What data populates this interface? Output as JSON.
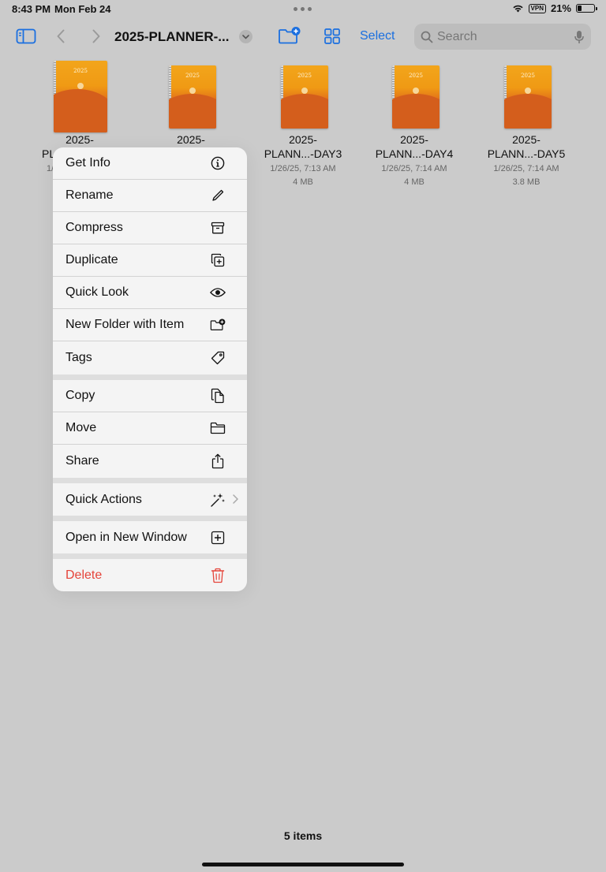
{
  "status_bar": {
    "time": "8:43 PM",
    "date": "Mon Feb 24",
    "vpn": "VPN",
    "battery": "21%"
  },
  "toolbar": {
    "title": "2025-PLANNER-...",
    "select_label": "Select",
    "search_placeholder": "Search",
    "accent_color": "#1a6fe0"
  },
  "files": [
    {
      "name_line1": "2025-",
      "name_line2": "PL",
      "meta_date": "1/",
      "meta_size": ""
    },
    {
      "name_line1": "2025-",
      "name_line2": "",
      "meta_date": "",
      "meta_size": ""
    },
    {
      "name_line1": "2025-",
      "name_line2": "PLANN...-DAY3",
      "meta_date": "1/26/25, 7:13 AM",
      "meta_size": "4 MB"
    },
    {
      "name_line1": "2025-",
      "name_line2": "PLANN...-DAY4",
      "meta_date": "1/26/25, 7:14 AM",
      "meta_size": "4 MB"
    },
    {
      "name_line1": "2025-",
      "name_line2": "PLANN...-DAY5",
      "meta_date": "1/26/25, 7:14 AM",
      "meta_size": "3.8 MB"
    }
  ],
  "thumbnail_year": "2025",
  "context_menu": {
    "items": [
      {
        "label": "Get Info",
        "icon": "info-icon"
      },
      {
        "label": "Rename",
        "icon": "pencil-icon"
      },
      {
        "label": "Compress",
        "icon": "archive-box-icon"
      },
      {
        "label": "Duplicate",
        "icon": "duplicate-icon"
      },
      {
        "label": "Quick Look",
        "icon": "eye-icon"
      },
      {
        "label": "New Folder with Item",
        "icon": "folder-plus-icon"
      },
      {
        "label": "Tags",
        "icon": "tag-icon"
      },
      {
        "label": "Copy",
        "icon": "copy-icon"
      },
      {
        "label": "Move",
        "icon": "folder-icon"
      },
      {
        "label": "Share",
        "icon": "share-icon"
      },
      {
        "label": "Quick Actions",
        "icon": "sparkles-icon"
      },
      {
        "label": "Open in New Window",
        "icon": "plus-square-icon"
      },
      {
        "label": "Delete",
        "icon": "trash-icon"
      }
    ],
    "danger_color": "#e5443a"
  },
  "footer": {
    "item_count": "5 items"
  }
}
